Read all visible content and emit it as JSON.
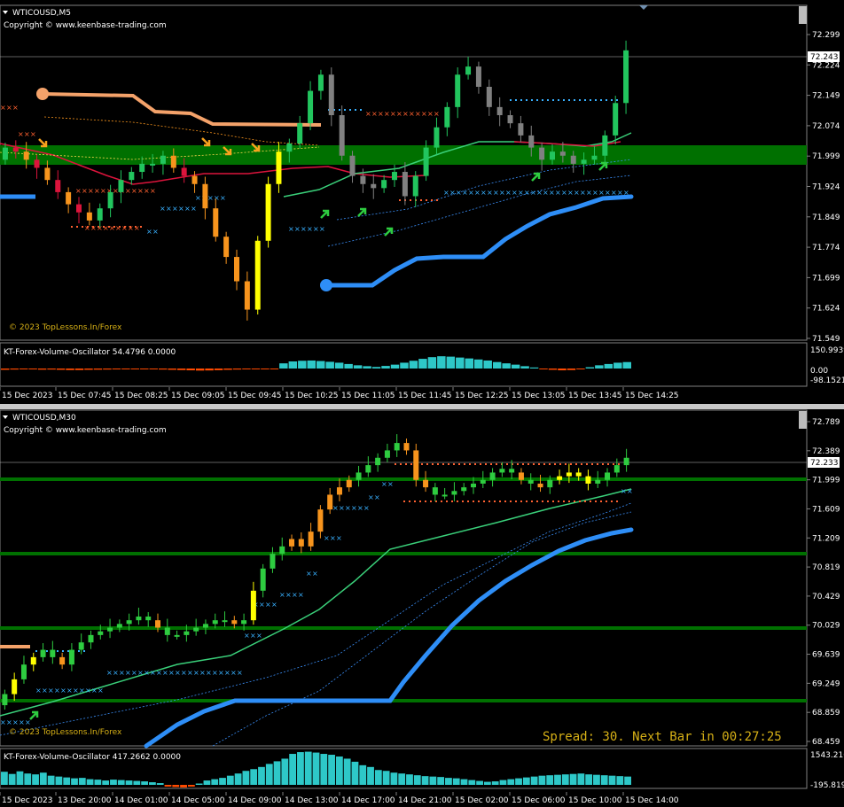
{
  "top": {
    "title": "WTICOUSD,M5",
    "copyright": "Copyright © www.keenbase-trading.com",
    "watermark": "© 2023 TopLessons.In/Forex",
    "price_ticks": [
      "72.299",
      "72.224",
      "72.149",
      "72.074",
      "71.999",
      "71.924",
      "71.849",
      "71.774",
      "71.699",
      "71.624",
      "71.549"
    ],
    "current_price": "72.243",
    "osc_label": "KT-Forex-Volume-Oscillator 54.4796 0.0000",
    "osc_ticks": [
      "150.9939",
      "0.00",
      "-98.1521"
    ],
    "time_labels": [
      "15 Dec 2023",
      "15 Dec 07:45",
      "15 Dec 08:25",
      "15 Dec 09:05",
      "15 Dec 09:45",
      "15 Dec 10:25",
      "15 Dec 11:05",
      "15 Dec 11:45",
      "15 Dec 12:25",
      "15 Dec 13:05",
      "15 Dec 13:45",
      "15 Dec 14:25"
    ]
  },
  "bottom": {
    "title": "WTICOUSD,M30",
    "copyright": "Copyright © www.keenbase-trading.com",
    "watermark": "© 2023 TopLessons.In/Forex",
    "spread": "Spread: 30. Next Bar in 00:27:25",
    "price_ticks": [
      "72.789",
      "72.389",
      "71.999",
      "71.609",
      "71.209",
      "70.819",
      "70.429",
      "70.029",
      "69.639",
      "69.249",
      "68.859",
      "68.459"
    ],
    "current_price": "72.233",
    "osc_label": "KT-Forex-Volume-Oscillator 417.2662 0.0000",
    "osc_ticks": [
      "1543.216",
      "-195.819"
    ],
    "time_labels": [
      "15 Dec 2023",
      "13 Dec 20:00",
      "14 Dec 01:00",
      "14 Dec 05:00",
      "14 Dec 09:00",
      "14 Dec 13:00",
      "14 Dec 17:00",
      "14 Dec 21:00",
      "15 Dec 02:00",
      "15 Dec 06:00",
      "15 Dec 10:00",
      "15 Dec 14:00"
    ]
  },
  "chart_data": [
    {
      "type": "candlestick",
      "title": "WTICOUSD,M5",
      "ylim": [
        71.549,
        72.299
      ],
      "last_price": 72.243,
      "close_approx": [
        72.02,
        72.01,
        71.99,
        71.97,
        71.94,
        71.91,
        71.88,
        71.86,
        71.84,
        71.87,
        71.91,
        71.94,
        71.96,
        71.98,
        71.98,
        72.0,
        71.97,
        71.95,
        71.93,
        71.87,
        71.8,
        71.75,
        71.69,
        71.62,
        71.79,
        71.93,
        72.01,
        72.03,
        72.08,
        72.16,
        72.2,
        72.1,
        72.0,
        71.95,
        71.93,
        71.92,
        71.94,
        71.96,
        71.9,
        71.95,
        72.02,
        72.07,
        72.12,
        72.2,
        72.22,
        72.17,
        72.12,
        72.1,
        72.08,
        72.05,
        72.02,
        71.99,
        72.01,
        72.0,
        71.98,
        71.99,
        72.0,
        72.05,
        72.13,
        72.26
      ],
      "colors": {
        "up": "#22c55e",
        "down_strong": "#f7941d",
        "neutral": "#808080",
        "bear": "#dc143c",
        "bull_strong": "#ffff00"
      },
      "volume_oscillator": {
        "min": -98.1521,
        "max": 150.9939,
        "last": 54.4796
      }
    },
    {
      "type": "candlestick",
      "title": "WTICOUSD,M30",
      "ylim": [
        68.459,
        72.789
      ],
      "last_price": 72.233,
      "close_approx": [
        69.1,
        69.3,
        69.5,
        69.6,
        69.7,
        69.6,
        69.5,
        69.7,
        69.8,
        69.9,
        69.95,
        70.0,
        70.05,
        70.1,
        70.15,
        70.1,
        70.0,
        69.9,
        69.9,
        69.95,
        70.0,
        70.05,
        70.1,
        70.1,
        70.05,
        70.1,
        70.5,
        70.8,
        71.0,
        71.1,
        71.2,
        71.1,
        71.3,
        71.6,
        71.8,
        71.9,
        72.0,
        72.1,
        72.2,
        72.3,
        72.4,
        72.5,
        72.4,
        72.0,
        71.9,
        71.8,
        71.8,
        71.85,
        71.9,
        71.95,
        72.0,
        72.1,
        72.15,
        72.1,
        72.0,
        71.95,
        71.9,
        72.0,
        72.05,
        72.1,
        72.05,
        71.95,
        72.0,
        72.1,
        72.2,
        72.3
      ],
      "horizontal_levels": [
        72.03,
        71.209,
        70.029,
        68.9
      ],
      "volume_oscillator": {
        "min": -195.819,
        "max": 1543.216,
        "last": 417.2662
      }
    }
  ]
}
